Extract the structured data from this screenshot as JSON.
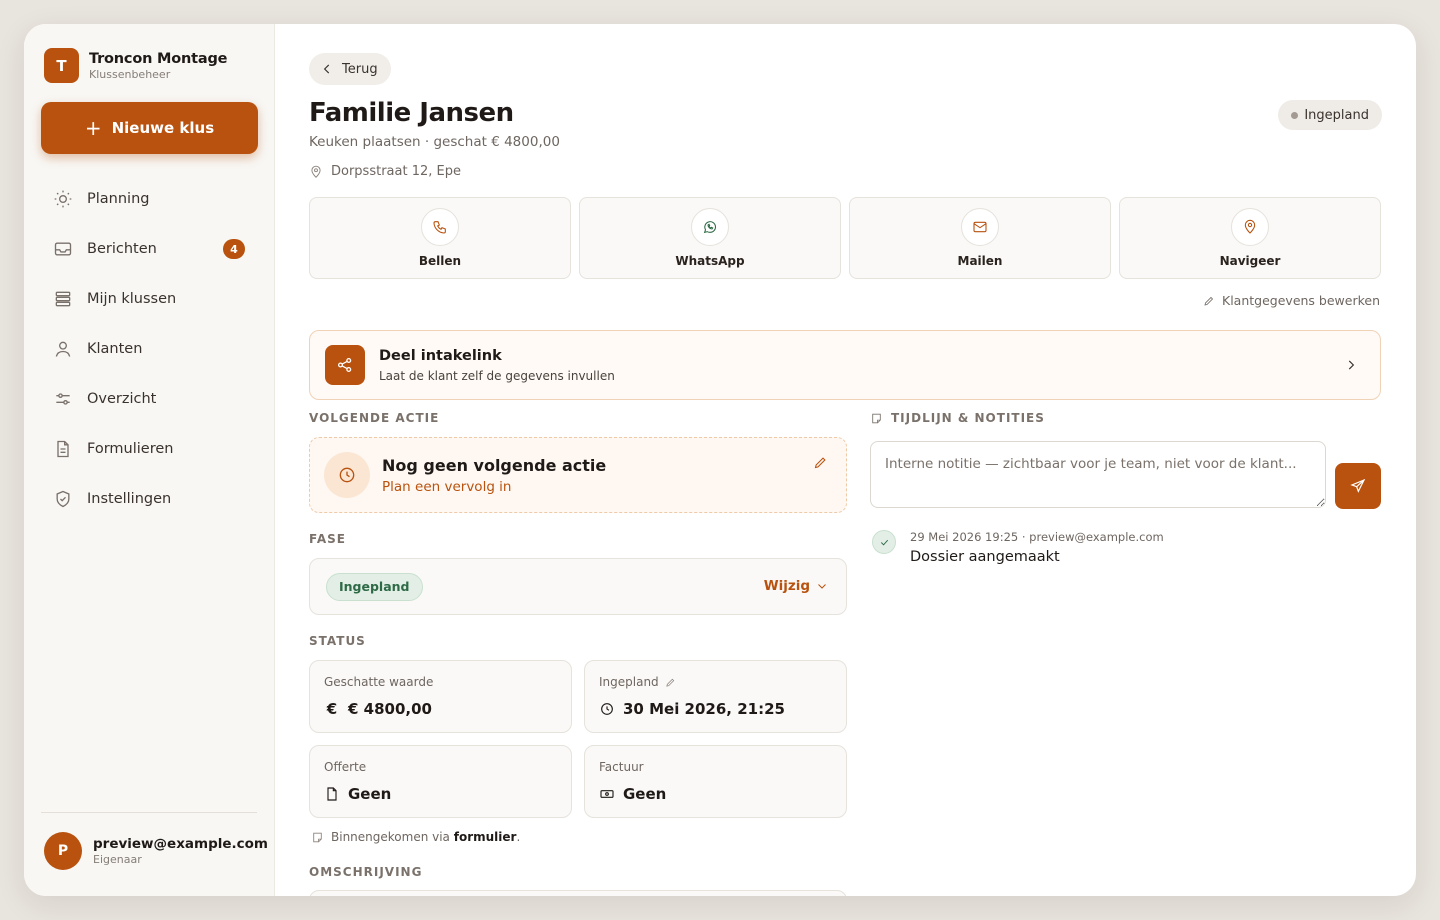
{
  "brand": {
    "initial": "T",
    "name": "Troncon Montage",
    "subtitle": "Klussenbeheer"
  },
  "new_job_label": "Nieuwe klus",
  "nav": [
    {
      "label": "Planning",
      "icon": "sun-icon"
    },
    {
      "label": "Berichten",
      "icon": "inbox-icon",
      "badge": "4"
    },
    {
      "label": "Mijn klussen",
      "icon": "stack-icon"
    },
    {
      "label": "Klanten",
      "icon": "user-icon"
    },
    {
      "label": "Overzicht",
      "icon": "sliders-icon"
    },
    {
      "label": "Formulieren",
      "icon": "file-icon"
    },
    {
      "label": "Instellingen",
      "icon": "shield-icon"
    }
  ],
  "user": {
    "initial": "P",
    "email": "preview@example.com",
    "role": "Eigenaar"
  },
  "header": {
    "back_label": "Terug",
    "title": "Familie Jansen",
    "subtitle": "Keuken plaatsen · geschat € 4800,00",
    "address": "Dorpsstraat 12, Epe",
    "status": "Ingepland"
  },
  "actions": [
    {
      "label": "Bellen",
      "icon": "phone-icon",
      "color": "#b8520e"
    },
    {
      "label": "WhatsApp",
      "icon": "whatsapp-icon",
      "color": "#2e6a46"
    },
    {
      "label": "Mailen",
      "icon": "mail-icon",
      "color": "#b8520e"
    },
    {
      "label": "Navigeer",
      "icon": "map-pin-icon",
      "color": "#b8520e"
    }
  ],
  "edit_client_label": "Klantgegevens bewerken",
  "intake": {
    "title": "Deel intakelink",
    "subtitle": "Laat de klant zelf de gegevens invullen"
  },
  "next_action": {
    "section": "Volgende actie",
    "title": "Nog geen volgende actie",
    "subtitle": "Plan een vervolg in"
  },
  "phase": {
    "section": "Fase",
    "value": "Ingepland",
    "change_label": "Wijzig"
  },
  "status": {
    "section": "Status",
    "cards": [
      {
        "label": "Geschatte waarde",
        "value": "€ 4800,00",
        "icon": "euro-icon"
      },
      {
        "label": "Ingepland",
        "value": "30 Mei 2026, 21:25",
        "icon": "clock-icon",
        "editable": true
      },
      {
        "label": "Offerte",
        "value": "Geen",
        "icon": "document-icon"
      },
      {
        "label": "Factuur",
        "value": "Geen",
        "icon": "banknote-icon"
      }
    ]
  },
  "via": {
    "prefix": "Binnengekomen via",
    "source": "formulier",
    "suffix": "."
  },
  "description_section": "Omschrijving",
  "timeline": {
    "section": "Tijdlijn & notities",
    "note_placeholder": "Interne notitie — zichtbaar voor je team, niet voor de klant...",
    "items": [
      {
        "meta": "29 Mei 2026 19:25 · preview@example.com",
        "text": "Dossier aangemaakt"
      }
    ]
  },
  "colors": {
    "accent": "#b8520e",
    "success": "#2e6a46",
    "background": "#e8e4de"
  }
}
